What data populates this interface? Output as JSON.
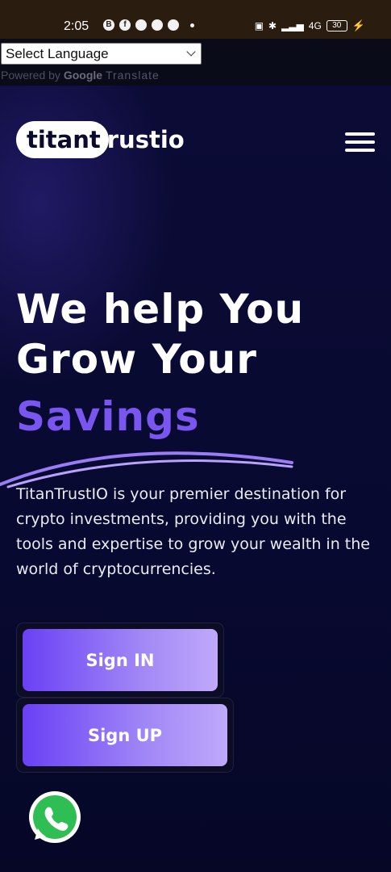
{
  "status_bar": {
    "time": "2:05",
    "notification_icons": [
      "b-icon",
      "facebook-icon",
      "snapchat-icon",
      "snapchat-icon",
      "snapchat-icon",
      "dot-icon"
    ],
    "network_label": "4G",
    "battery": "30"
  },
  "translate_widget": {
    "selected_language": "Select Language",
    "powered_by": "Powered by",
    "google": "Google",
    "translate": "Translate"
  },
  "header": {
    "logo_part1": "titant",
    "logo_part2": "rustio",
    "menu_icon": "hamburger-icon"
  },
  "hero": {
    "title_line1": "We help You",
    "title_line2": "Grow Your",
    "title_accent": "Savings",
    "description": "TitanTrustIO is your premier destination for crypto investments, providing you with the tools and expertise to grow your wealth in the world of cryptocurrencies."
  },
  "buttons": {
    "sign_in": "Sign IN",
    "sign_up": "Sign UP"
  },
  "floating": {
    "icon": "whatsapp-icon"
  },
  "colors": {
    "accent": "#7a56f0",
    "background": "#07082a",
    "button_start": "#6a40f5",
    "button_end": "#bfa9fb"
  }
}
